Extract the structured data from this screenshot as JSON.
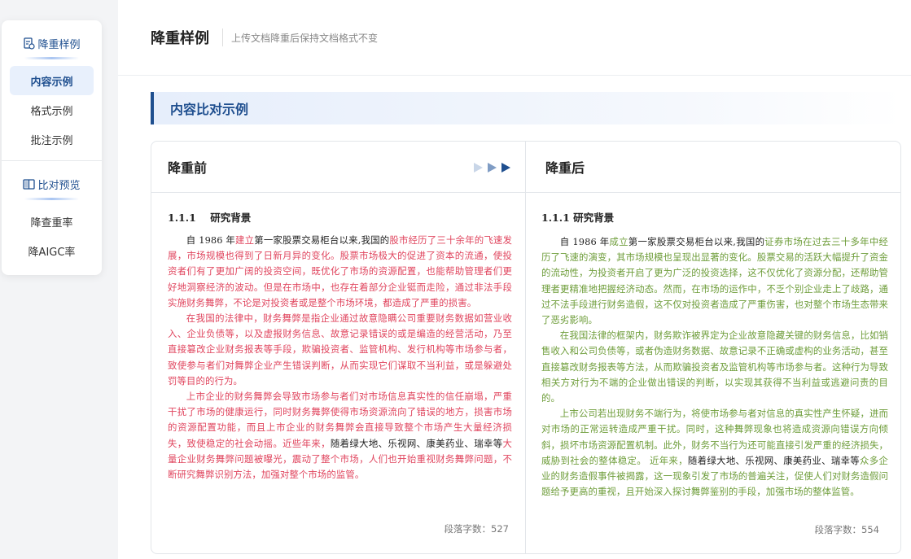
{
  "sidebar": {
    "group1_title": "降重样例",
    "group1_icon": "document-edit-icon",
    "items1": [
      "内容示例",
      "格式示例",
      "批注示例"
    ],
    "group2_title": "比对预览",
    "group2_icon": "book-compare-icon",
    "items2": [
      "降查重率",
      "降AIGC率"
    ],
    "active_item": "内容示例",
    "accent": "#1f4f8f"
  },
  "header": {
    "title": "降重样例",
    "subtitle": "上传文档降重后保持文档格式不变"
  },
  "section": {
    "title": "内容比对示例"
  },
  "before": {
    "title": "降重前",
    "heading": "1.1.1    研究背景",
    "count": "段落字数：527",
    "highlight_color": "#e0455e",
    "p1": [
      {
        "t": "自 1986 年",
        "c": "blk"
      },
      {
        "t": "建立",
        "c": "red"
      },
      {
        "t": "第一家股票交易柜台以来,我国的",
        "c": "blk"
      },
      {
        "t": "股市经历了三十余年的飞速发展，市场规模也得到了日新月异的变化。股票市场极大的促进了资本的流通，使投资者们有了更加广阔的投资空间，既优化了市场的资源配置，也能帮助管理者们更好地洞察经济的波动。但是在市场中，也存在着部分企业铤而走险，通过非法手段实施财务舞弊，不论是对投资者或是整个市场环境，都造成了严重的损害。",
        "c": "red"
      }
    ],
    "p2": [
      {
        "t": "在我国的法律中，财务舞弊是指企业通过故意隐瞒公司重要财务数据如营业收入、企业负债等，以及虚报财务信息、故意记录错误的或是编造的经营活动，乃至直接篡改企业财务报表等手段，欺骗投资者、监管机构、发行机构等市场参与者，致使参与者们对舞弊企业产生错误判断，从而实现它们谋取不当利益，或是躲避处罚等目的的行为。",
        "c": "red"
      }
    ],
    "p3": [
      {
        "t": "上市企业的财务舞弊会导致市场参与者们对市场信息真实性的信任崩塌，严重干扰了市场的健康运行，同时财务舞弊使得市场资源流向了错误的地方，损害市场的资源配置功能，而且上市企业的财务舞弊会直接导致整个市场产生大量经济损失，致使稳定的社会动摇。近些年来，",
        "c": "red"
      },
      {
        "t": "随着绿大地、乐视网、康美药业、瑞幸等",
        "c": "blk"
      },
      {
        "t": "大量企业财务舞弊问题被曝光，震动了整个市场，人们也开始重视财务舞弊问题，不断研究舞弊识别方法，加强对整个市场的监管。",
        "c": "red"
      }
    ]
  },
  "after": {
    "title": "降重后",
    "heading": "1.1.1 研究背景",
    "count": "段落字数：554",
    "highlight_color": "#6e9d3a",
    "p1": [
      {
        "t": "自 1986 年",
        "c": "blk"
      },
      {
        "t": "成立",
        "c": "green"
      },
      {
        "t": "第一家股票交易柜台以来,我国的",
        "c": "blk"
      },
      {
        "t": "证券市场在过去三十多年中经历了飞速的演变，其市场规模也呈现出显著的变化。股票交易的活跃大幅提升了资金的流动性，为投资者开启了更为广泛的投资选择，这不仅优化了资源分配，还帮助管理者更精准地把握经济动态。然而，在市场的运作中，不乏个别企业走上了歧路，通过不法手段进行财务造假，这不仅对投资者造成了严重伤害，也对整个市场生态带来了恶劣影响。",
        "c": "green"
      }
    ],
    "p2": [
      {
        "t": "在我国法律的框架内，财务欺诈被界定为企业故意隐藏关键的财务信息，比如销售收入和公司负债等，或者伪造财务数据、故意记录不正确或虚构的业务活动，甚至直接篡改财务报表等方法，从而欺骗投资者及监管机构等市场参与者。这种行为导致相关方对行为不端的企业做出错误的判断，以实现其获得不当利益或逃避问责的目的。",
        "c": "green"
      }
    ],
    "p3": [
      {
        "t": "上市公司若出现财务不端行为，将使市场参与者对信息的真实性产生怀疑，进而对市场的正常运转造成严重干扰。同时，这种舞弊现象也将造成资源向错误方向倾斜，损坏市场资源配置机制。此外，财务不当行为还可能直接引发严重的经济损失，威胁到社会的整体稳定。 近年来，",
        "c": "green"
      },
      {
        "t": "随着绿大地、乐视网、康美药业、瑞幸等",
        "c": "blk"
      },
      {
        "t": "众多企业的财务造假事件被揭露，这一现象引发了市场的普遍关注，促使人们对财务造假问题给予更高的重视，且开始深入探讨舞弊鉴别的手段，加强市场的整体监管。",
        "c": "green"
      }
    ]
  },
  "arrow_icons": [
    "play-arrow-light-icon",
    "play-arrow-mid-icon",
    "play-arrow-dark-icon"
  ]
}
